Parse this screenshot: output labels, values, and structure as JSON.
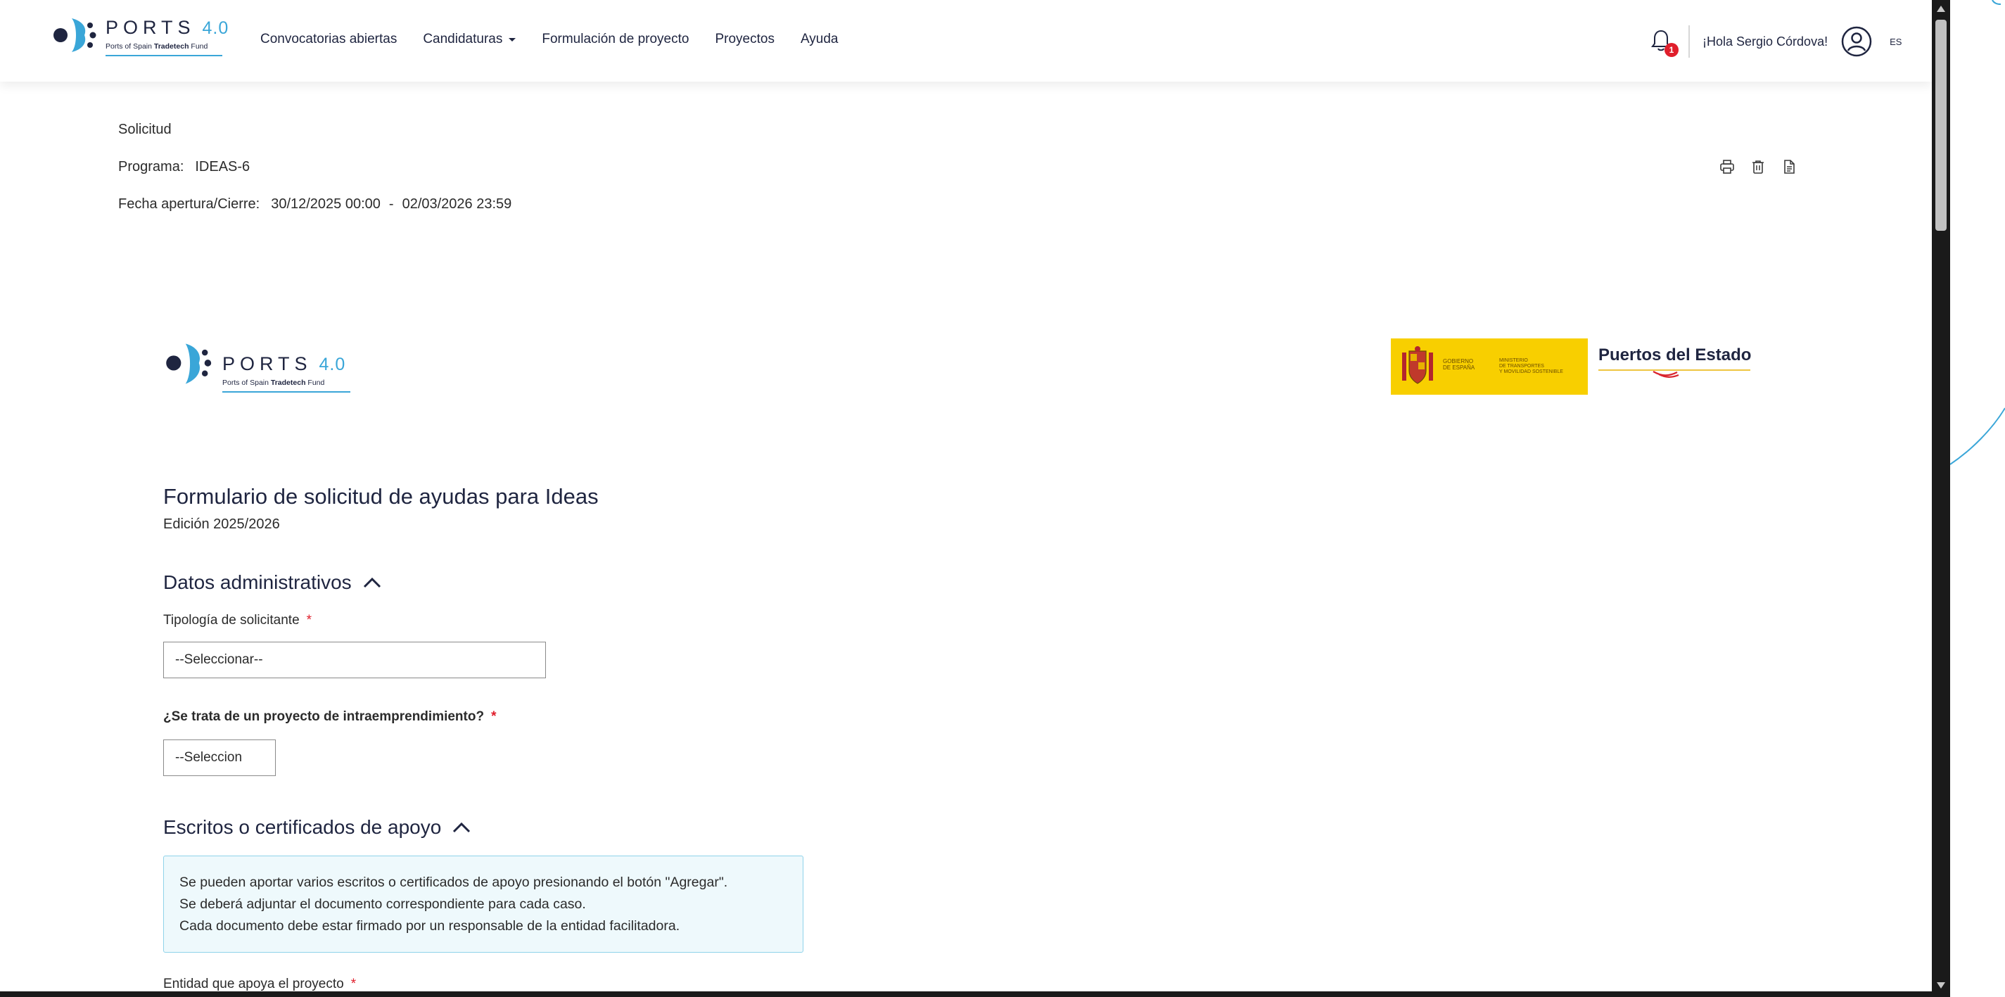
{
  "header": {
    "brand": {
      "name": "PORTS",
      "version": "4.0",
      "tagline_pre": "Ports of Spain ",
      "tagline_bold": "Tradetech",
      "tagline_post": " Fund"
    },
    "nav": [
      {
        "label": "Convocatorias abiertas"
      },
      {
        "label": "Candidaturas"
      },
      {
        "label": "Formulación de proyecto"
      },
      {
        "label": "Proyectos"
      },
      {
        "label": "Ayuda"
      }
    ],
    "notifications": "1",
    "greeting": "¡Hola Sergio Córdova!",
    "language": "ES"
  },
  "request": {
    "title": "Solicitud",
    "program_label": "Programa:",
    "program_value": "IDEAS-6",
    "dates_label": "Fecha apertura/Cierre:",
    "date_open": "30/12/2025 00:00",
    "date_sep": "-",
    "date_close": "02/03/2026 23:59"
  },
  "form": {
    "gov_line1": "GOBIERNO\nDE ESPAÑA",
    "gov_line2": "MINISTERIO\nDE TRANSPORTES\nY MOVILIDAD SOSTENIBLE",
    "partner_name": "Puertos del Estado",
    "title": "Formulario de solicitud de ayudas para Ideas",
    "edition": "Edición 2025/2026",
    "section_admin": "Datos administrativos",
    "applicant_type_label": "Tipología de solicitante",
    "applicant_type_value": "--Seleccionar--",
    "intra_label": "¿Se trata de un proyecto de intraemprendimiento?",
    "intra_value": "--Seleccion",
    "section_support": "Escritos o certificados de apoyo",
    "note_lines": [
      "Se pueden aportar varios escritos o certificados de apoyo presionando el botón \"Agregar\".",
      "Se deberá adjuntar el documento correspondiente para cada caso.",
      "Cada documento debe estar firmado por un responsable de la entidad facilitadora."
    ],
    "supporting_entity_label": "Entidad que apoya el proyecto",
    "required_mark": "*"
  }
}
